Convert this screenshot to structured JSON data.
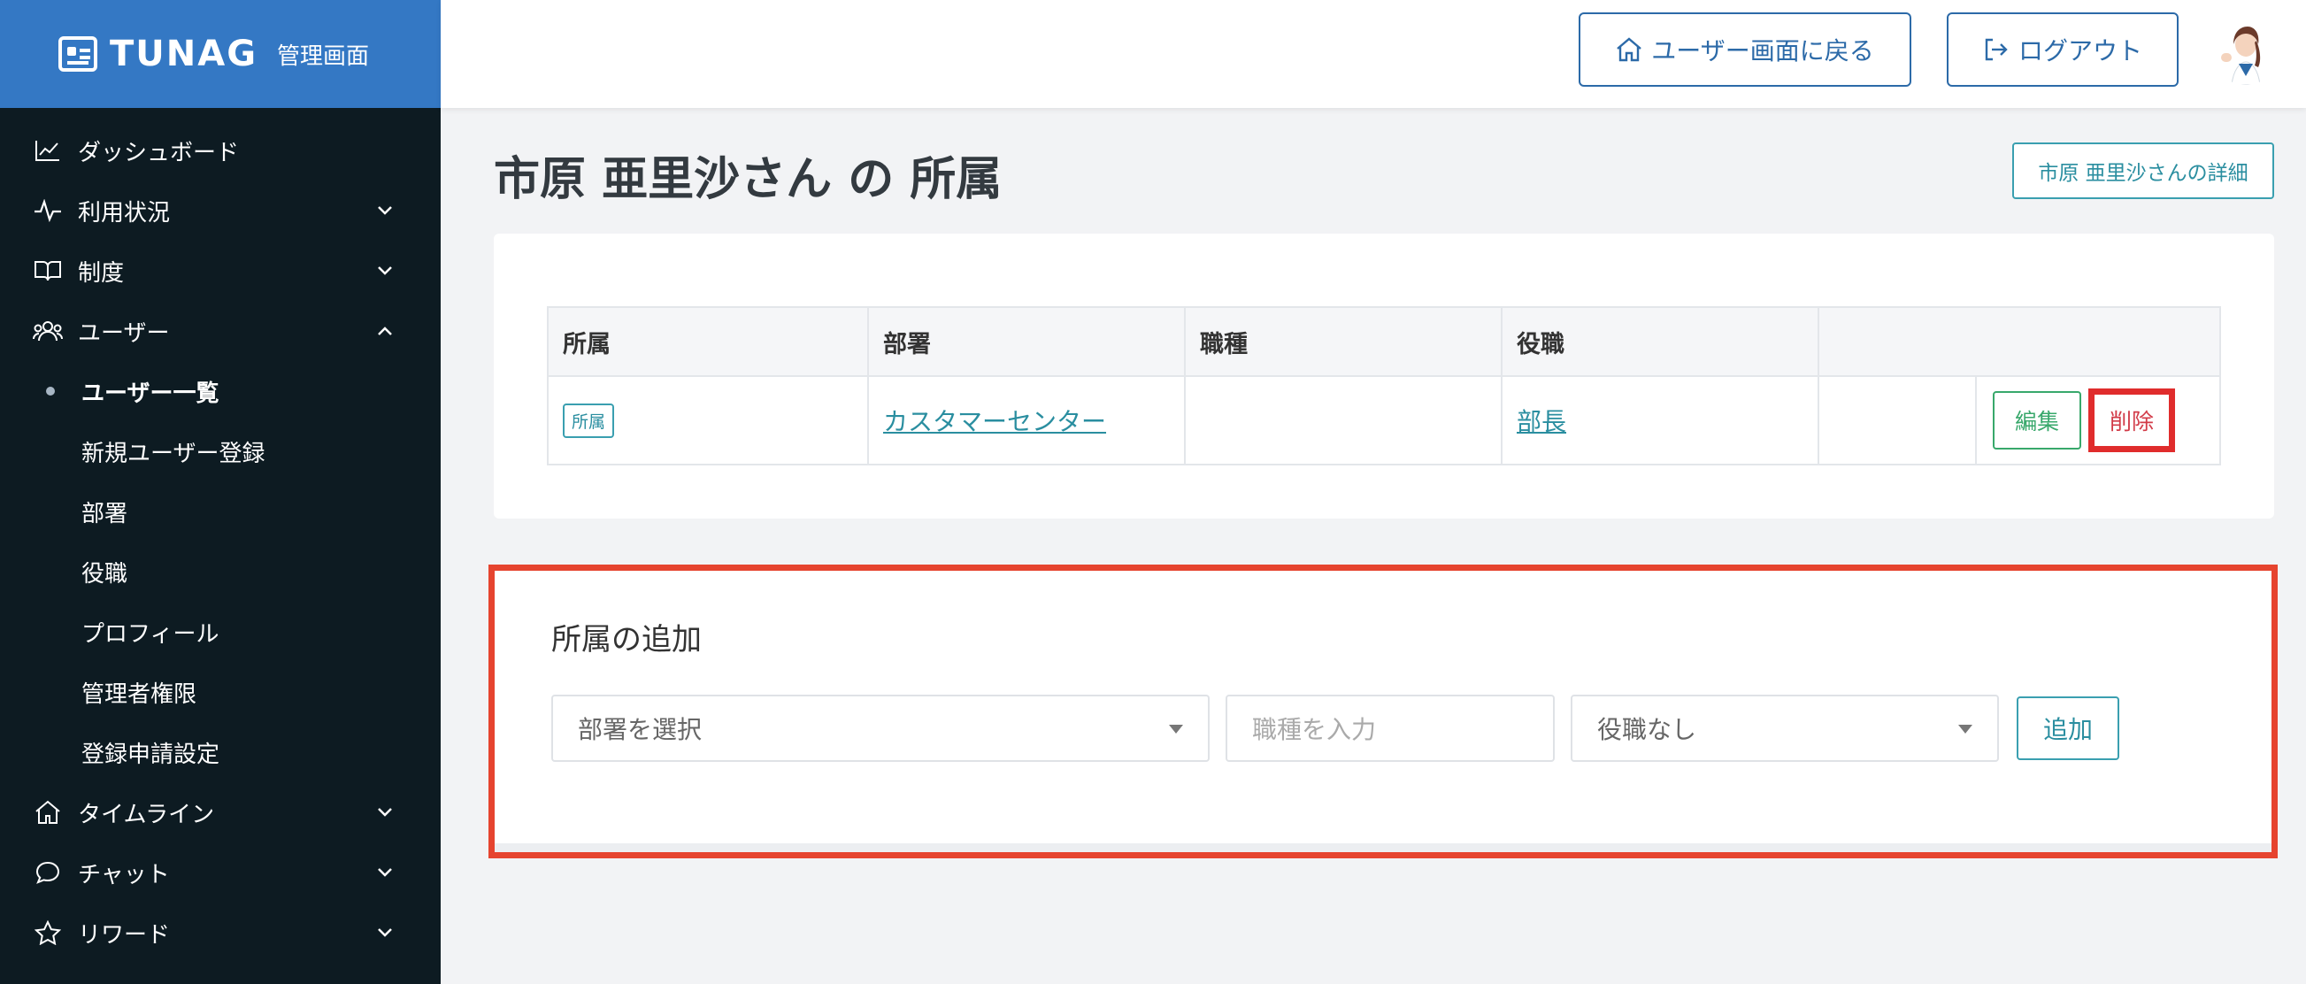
{
  "brand": {
    "name": "TUNAG",
    "sub": "管理画面"
  },
  "sidebar": {
    "items": [
      {
        "label": "ダッシュボード",
        "icon": "chart-line-icon"
      },
      {
        "label": "利用状況",
        "icon": "pulse-icon"
      },
      {
        "label": "制度",
        "icon": "book-icon"
      },
      {
        "label": "ユーザー",
        "icon": "users-icon"
      },
      {
        "label": "タイムライン",
        "icon": "home-icon"
      },
      {
        "label": "チャット",
        "icon": "chat-icon"
      },
      {
        "label": "リワード",
        "icon": "star-icon"
      }
    ],
    "user_sub": [
      {
        "label": "ユーザー一覧",
        "active": true
      },
      {
        "label": "新規ユーザー登録"
      },
      {
        "label": "部署"
      },
      {
        "label": "役職"
      },
      {
        "label": "プロフィール"
      },
      {
        "label": "管理者権限"
      },
      {
        "label": "登録申請設定"
      }
    ]
  },
  "header": {
    "user_screen_label": "ユーザー画面に戻る",
    "logout_label": "ログアウト"
  },
  "page": {
    "title": "市原 亜里沙さん の 所属",
    "detail_button": "市原 亜里沙さんの詳細"
  },
  "table": {
    "headers": [
      "所属",
      "部署",
      "職種",
      "役職",
      ""
    ],
    "rows": [
      {
        "badge": "所属",
        "department": "カスタマーセンター",
        "job": "",
        "position": "部長",
        "edit": "編集",
        "delete": "削除"
      }
    ]
  },
  "add_section": {
    "title": "所属の追加",
    "department_placeholder": "部署を選択",
    "job_placeholder": "職種を入力",
    "position_default": "役職なし",
    "add_button": "追加"
  },
  "colors": {
    "brand": "#3478c4",
    "sidebar": "#0d1b22",
    "accent": "#2a8ea0",
    "highlight": "#e6442f"
  }
}
